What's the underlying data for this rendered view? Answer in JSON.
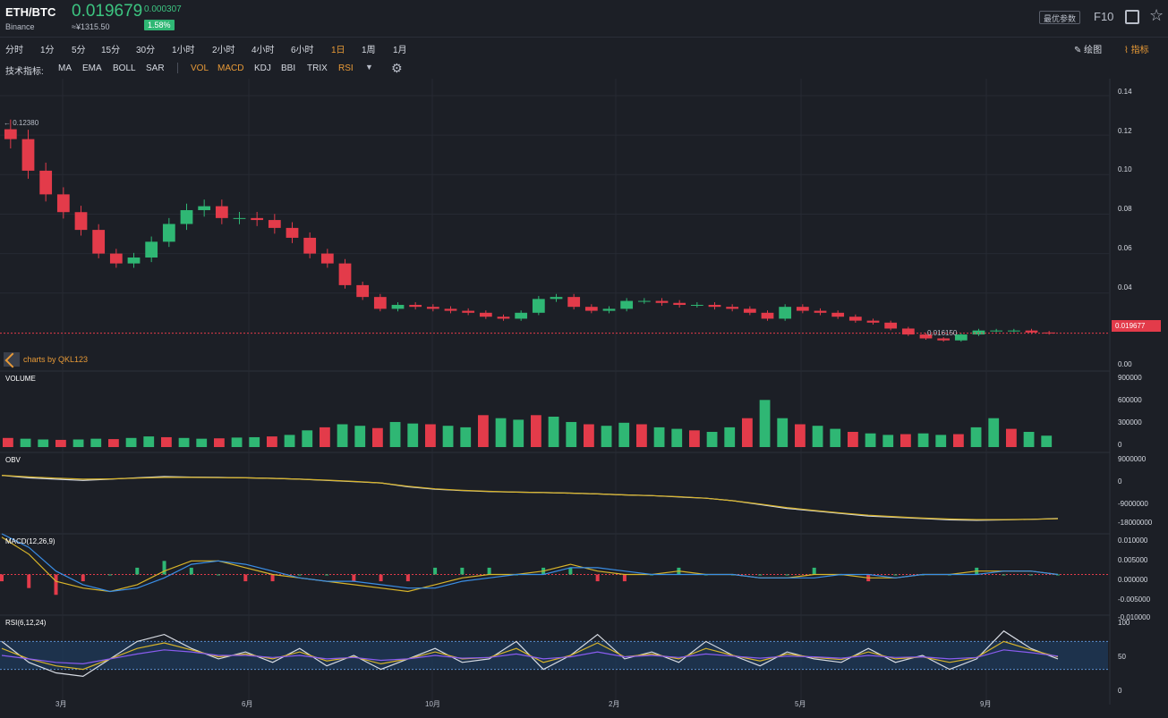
{
  "header": {
    "symbol": "ETH/BTC",
    "exchange": "Binance",
    "price": "0.019679",
    "change": "0.000307",
    "cny": "≈¥1315.50",
    "change_pct": "1.58%",
    "params_button": "最优参数",
    "f10": "F10",
    "expand_icon": "expand-icon",
    "star_icon": "star-icon"
  },
  "timeframes": [
    {
      "label": "分时",
      "active": false
    },
    {
      "label": "1分",
      "active": false
    },
    {
      "label": "5分",
      "active": false
    },
    {
      "label": "15分",
      "active": false
    },
    {
      "label": "30分",
      "active": false
    },
    {
      "label": "1小时",
      "active": false
    },
    {
      "label": "2小时",
      "active": false
    },
    {
      "label": "4小时",
      "active": false
    },
    {
      "label": "6小时",
      "active": false
    },
    {
      "label": "1日",
      "active": true
    },
    {
      "label": "1周",
      "active": false
    },
    {
      "label": "1月",
      "active": false
    }
  ],
  "tools": {
    "draw": "绘图",
    "indicators": "指标"
  },
  "indicator_bar": {
    "label": "技术指标:",
    "overlays": [
      {
        "label": "MA",
        "on": false
      },
      {
        "label": "EMA",
        "on": false
      },
      {
        "label": "BOLL",
        "on": false
      },
      {
        "label": "SAR",
        "on": false
      }
    ],
    "panels": [
      {
        "label": "VOL",
        "on": true
      },
      {
        "label": "MACD",
        "on": true
      },
      {
        "label": "KDJ",
        "on": false
      },
      {
        "label": "BBI",
        "on": false
      },
      {
        "label": "TRIX",
        "on": false
      },
      {
        "label": "RSI",
        "on": true
      }
    ]
  },
  "credit": "charts by QKL123",
  "colors": {
    "up": "#2fb774",
    "down": "#e33b4a",
    "accent": "#e89a37",
    "yellow": "#d8b42a",
    "blue": "#3a8ee6",
    "purple": "#8a5cf0",
    "white": "#d7dbe3"
  },
  "chart_data": [
    {
      "type": "candlestick",
      "panel": "price",
      "y_ticks": [
        "0.14",
        "0.12",
        "0.10",
        "0.08",
        "0.06",
        "0.04",
        "0.00"
      ],
      "ylim": [
        0,
        0.145
      ],
      "x_ticks": [
        "3月",
        "6月",
        "10月",
        "2月",
        "5月",
        "9月"
      ],
      "annotations": {
        "high": "0.12380",
        "low": "0.016150",
        "last": "0.019677"
      },
      "close": [
        0.118,
        0.102,
        0.09,
        0.081,
        0.072,
        0.06,
        0.055,
        0.058,
        0.066,
        0.075,
        0.082,
        0.084,
        0.078,
        0.078,
        0.077,
        0.073,
        0.068,
        0.06,
        0.055,
        0.044,
        0.038,
        0.032,
        0.034,
        0.033,
        0.032,
        0.031,
        0.03,
        0.028,
        0.027,
        0.03,
        0.037,
        0.038,
        0.033,
        0.031,
        0.032,
        0.036,
        0.036,
        0.035,
        0.034,
        0.034,
        0.033,
        0.032,
        0.03,
        0.027,
        0.033,
        0.031,
        0.03,
        0.028,
        0.026,
        0.025,
        0.022,
        0.019,
        0.017,
        0.016,
        0.019,
        0.021,
        0.021,
        0.021,
        0.02,
        0.0197
      ]
    },
    {
      "type": "bar",
      "panel": "VOLUME",
      "y_ticks": [
        "900000",
        "600000",
        "300000",
        "0"
      ],
      "ylim": [
        0,
        1000000
      ],
      "values": [
        120000,
        110000,
        100000,
        95000,
        100000,
        110000,
        105000,
        120000,
        140000,
        130000,
        120000,
        110000,
        115000,
        125000,
        130000,
        140000,
        160000,
        220000,
        260000,
        300000,
        280000,
        250000,
        330000,
        310000,
        300000,
        280000,
        260000,
        420000,
        380000,
        360000,
        420000,
        400000,
        330000,
        300000,
        280000,
        320000,
        300000,
        260000,
        240000,
        220000,
        200000,
        260000,
        380000,
        620000,
        380000,
        300000,
        280000,
        240000,
        200000,
        180000,
        160000,
        170000,
        180000,
        160000,
        170000,
        260000,
        380000,
        240000,
        200000,
        150000
      ]
    },
    {
      "type": "line",
      "panel": "OBV",
      "y_ticks": [
        "9000000",
        "0",
        "-9000000",
        "-18000000"
      ],
      "ylim": [
        -20000000,
        12000000
      ],
      "series": [
        {
          "name": "",
          "values": [
            3000000,
            2000000,
            1500000,
            1000000,
            1500000,
            2000000,
            2500000,
            2300000,
            2200000,
            2000000,
            1800000,
            1500000,
            1000000,
            500000,
            0,
            -1500000,
            -2500000,
            -3000000,
            -3400000,
            -3600000,
            -3800000,
            -4000000,
            -4300000,
            -4700000,
            -5000000,
            -5500000,
            -6000000,
            -7000000,
            -8500000,
            -10000000,
            -11000000,
            -12000000,
            -13000000,
            -13500000,
            -14000000,
            -14500000,
            -14700000,
            -14500000,
            -14300000,
            -14000000
          ]
        },
        {
          "name": "",
          "values": [
            3000000,
            2400000,
            1900000,
            1500000,
            1600000,
            1900000,
            2200000,
            2200000,
            2100000,
            2000000,
            1800000,
            1500000,
            1100000,
            600000,
            0,
            -1300000,
            -2300000,
            -2900000,
            -3300000,
            -3600000,
            -3800000,
            -4000000,
            -4300000,
            -4700000,
            -5000000,
            -5400000,
            -6000000,
            -7000000,
            -8300000,
            -9700000,
            -10800000,
            -11800000,
            -12700000,
            -13300000,
            -13800000,
            -14200000,
            -14400000,
            -14400000,
            -14300000,
            -14100000
          ]
        }
      ]
    },
    {
      "type": "line",
      "panel": "MACD(12,26,9)",
      "y_ticks": [
        "0.010000",
        "0.005000",
        "0.000000",
        "-0.005000",
        "-0.010000"
      ],
      "ylim": [
        -0.012,
        0.012
      ],
      "series": [
        {
          "name": "",
          "values": [
            0.011,
            0.006,
            -0.002,
            -0.004,
            -0.005,
            -0.003,
            0.001,
            0.004,
            0.004,
            0.002,
            0.0,
            -0.001,
            -0.002,
            -0.003,
            -0.004,
            -0.005,
            -0.003,
            -0.001,
            0.0,
            0.0,
            0.001,
            0.003,
            0.001,
            0.0,
            0.0,
            0.001,
            0.0,
            0.0,
            -0.001,
            -0.001,
            0.0,
            0.0,
            -0.001,
            -0.001,
            0.0,
            0.0,
            0.001,
            0.001,
            0.001,
            0.0
          ]
        },
        {
          "name": "",
          "values": [
            0.012,
            0.008,
            0.001,
            -0.003,
            -0.005,
            -0.004,
            -0.001,
            0.003,
            0.004,
            0.003,
            0.001,
            -0.001,
            -0.002,
            -0.002,
            -0.003,
            -0.004,
            -0.004,
            -0.002,
            -0.001,
            0.0,
            0.0,
            0.002,
            0.002,
            0.001,
            0.0,
            0.0,
            0.0,
            0.0,
            -0.001,
            -0.001,
            -0.001,
            0.0,
            0.0,
            -0.001,
            0.0,
            0.0,
            0.0,
            0.001,
            0.001,
            0.0
          ]
        }
      ]
    },
    {
      "type": "line",
      "panel": "RSI(6,12,24)",
      "y_ticks": [
        "100",
        "50",
        "0"
      ],
      "ylim": [
        0,
        100
      ],
      "bands": [
        30,
        70
      ],
      "series": [
        {
          "name": "",
          "values": [
            70,
            40,
            25,
            20,
            45,
            70,
            80,
            60,
            45,
            55,
            40,
            60,
            35,
            50,
            30,
            45,
            60,
            40,
            45,
            70,
            30,
            50,
            80,
            45,
            55,
            40,
            70,
            50,
            35,
            55,
            45,
            40,
            60,
            40,
            50,
            30,
            45,
            85,
            60,
            45
          ]
        },
        {
          "name": "",
          "values": [
            60,
            45,
            35,
            30,
            45,
            60,
            68,
            58,
            48,
            52,
            45,
            55,
            42,
            48,
            38,
            45,
            55,
            45,
            47,
            60,
            40,
            50,
            68,
            48,
            52,
            45,
            60,
            50,
            42,
            52,
            47,
            44,
            55,
            45,
            48,
            40,
            47,
            70,
            58,
            48
          ]
        },
        {
          "name": "",
          "values": [
            50,
            45,
            40,
            38,
            45,
            52,
            58,
            55,
            50,
            50,
            47,
            50,
            45,
            47,
            43,
            45,
            50,
            46,
            47,
            52,
            45,
            48,
            55,
            48,
            50,
            47,
            52,
            49,
            46,
            49,
            48,
            46,
            50,
            47,
            48,
            45,
            47,
            58,
            54,
            49
          ]
        }
      ]
    }
  ]
}
